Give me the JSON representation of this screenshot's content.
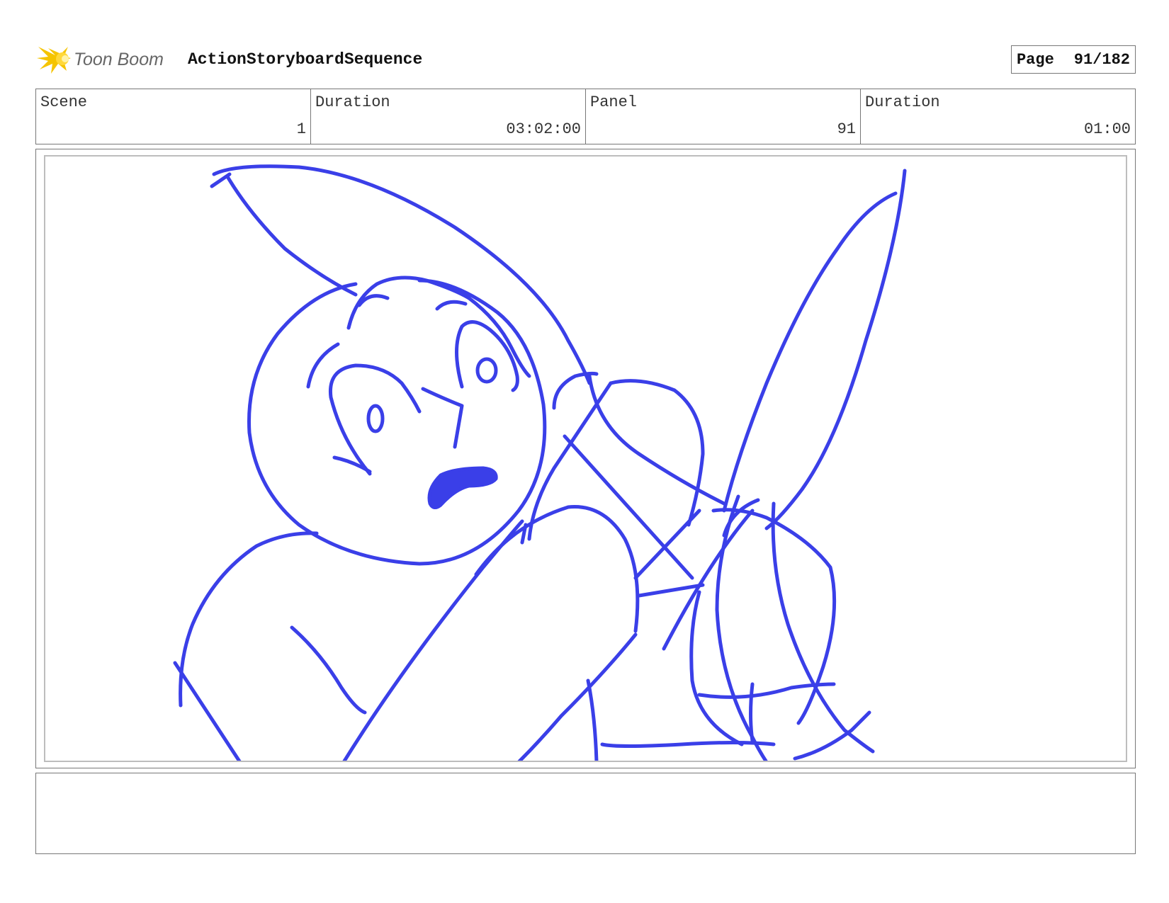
{
  "header": {
    "logo_text": "Toon Boom",
    "title": "ActionStoryboardSequence",
    "page_label": "Page",
    "page_value": "91/182"
  },
  "info": {
    "scene_label": "Scene",
    "scene_value": "1",
    "scene_duration_label": "Duration",
    "scene_duration_value": "03:02:00",
    "panel_label": "Panel",
    "panel_value": "91",
    "panel_duration_label": "Duration",
    "panel_duration_value": "01:00"
  },
  "panel": {
    "stroke_color": "#3a3fe8"
  },
  "notes": {
    "text": ""
  },
  "colors": {
    "logo_star": "#f5c400",
    "logo_text": "#666666",
    "border": "#777777",
    "sketch": "#3a3fe8"
  }
}
